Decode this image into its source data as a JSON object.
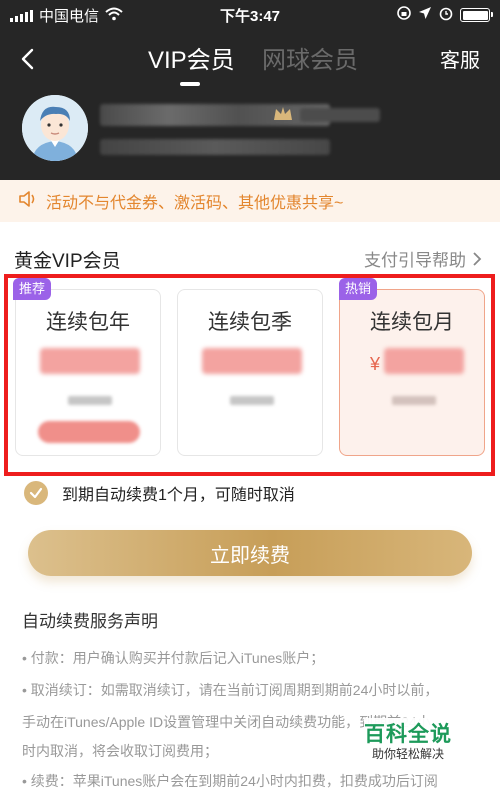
{
  "status_bar": {
    "carrier": "中国电信",
    "time": "下午3:47"
  },
  "nav": {
    "tabs": [
      {
        "label": "VIP会员",
        "active": true
      },
      {
        "label": "网球会员",
        "active": false
      }
    ],
    "service_label": "客服"
  },
  "notice": {
    "text": "活动不与代金券、激活码、其他优惠共享~",
    "color": "#e3862e"
  },
  "plans_section": {
    "title": "黄金VIP会员",
    "help_label": "支付引导帮助",
    "plans": [
      {
        "name": "连续包年",
        "badge": "推荐",
        "selected": false
      },
      {
        "name": "连续包季",
        "badge": "",
        "selected": false
      },
      {
        "name": "连续包月",
        "badge": "热销",
        "selected": true,
        "currency": "¥"
      }
    ],
    "highlight_color": "#ee1d1d"
  },
  "renew": {
    "checked": true,
    "text": "到期自动续费1个月，可随时取消",
    "button_label": "立即续费"
  },
  "declaration": {
    "title": "自动续费服务声明",
    "lines": [
      "• 付款：用户确认购买并付款后记入iTunes账户；",
      "• 取消续订：如需取消续订，请在当前订阅周期到期前24小时以前，",
      "手动在iTunes/Apple ID设置管理中关闭自动续费功能，到期前24小",
      "时内取消，将会收取订阅费用；",
      "• 续费：苹果iTunes账户会在到期前24小时内扣费，扣费成功后订阅"
    ]
  },
  "watermark": {
    "title": "百科全说",
    "subtitle": "助你轻松解决"
  },
  "colors": {
    "header_bg": "#262626",
    "gold": "#d9b77b",
    "badge": "#9b62e8"
  }
}
